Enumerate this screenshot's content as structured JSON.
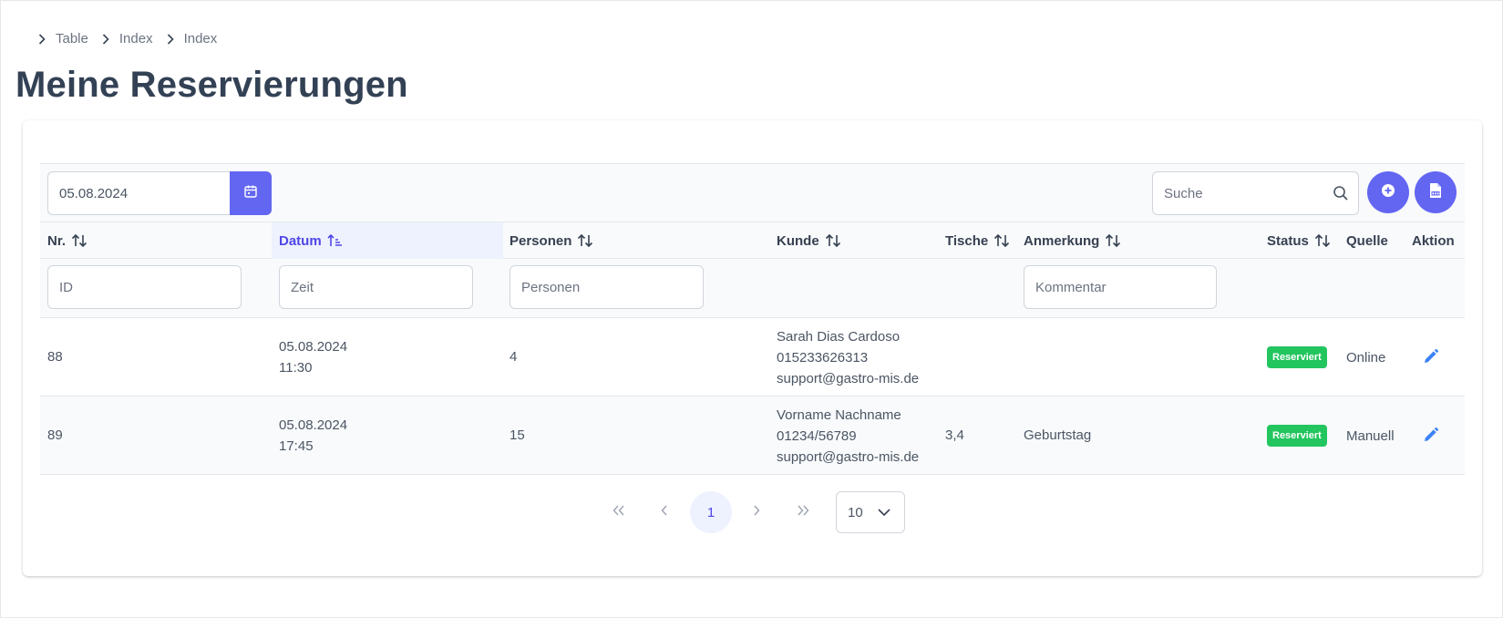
{
  "breadcrumb": [
    "Table",
    "Index",
    "Index"
  ],
  "page_title": "Meine Reservierungen",
  "toolbar": {
    "date_value": "05.08.2024",
    "search_placeholder": "Suche"
  },
  "columns": {
    "nr": "Nr.",
    "datum": "Datum",
    "personen": "Personen",
    "kunde": "Kunde",
    "tische": "Tische",
    "anmerkung": "Anmerkung",
    "status": "Status",
    "quelle": "Quelle",
    "aktion": "Aktion"
  },
  "filters": {
    "id_placeholder": "ID",
    "zeit_placeholder": "Zeit",
    "personen_placeholder": "Personen",
    "kommentar_placeholder": "Kommentar"
  },
  "rows": [
    {
      "nr": "88",
      "date": "05.08.2024",
      "time": "11:30",
      "personen": "4",
      "kunde_name": "Sarah Dias Cardoso",
      "kunde_phone": "015233626313",
      "kunde_email": "support@gastro-mis.de",
      "tische": "",
      "anmerkung": "",
      "status": "Reserviert",
      "quelle": "Online"
    },
    {
      "nr": "89",
      "date": "05.08.2024",
      "time": "17:45",
      "personen": "15",
      "kunde_name": "Vorname Nachname",
      "kunde_phone": "01234/56789",
      "kunde_email": "support@gastro-mis.de",
      "tische": "3,4",
      "anmerkung": "Geburtstag",
      "status": "Reserviert",
      "quelle": "Manuell"
    }
  ],
  "pagination": {
    "current_page": "1",
    "rows_per_page": "10"
  },
  "colors": {
    "accent": "#6366f1",
    "status_green": "#22c55e",
    "edit_blue": "#3b82f6"
  }
}
